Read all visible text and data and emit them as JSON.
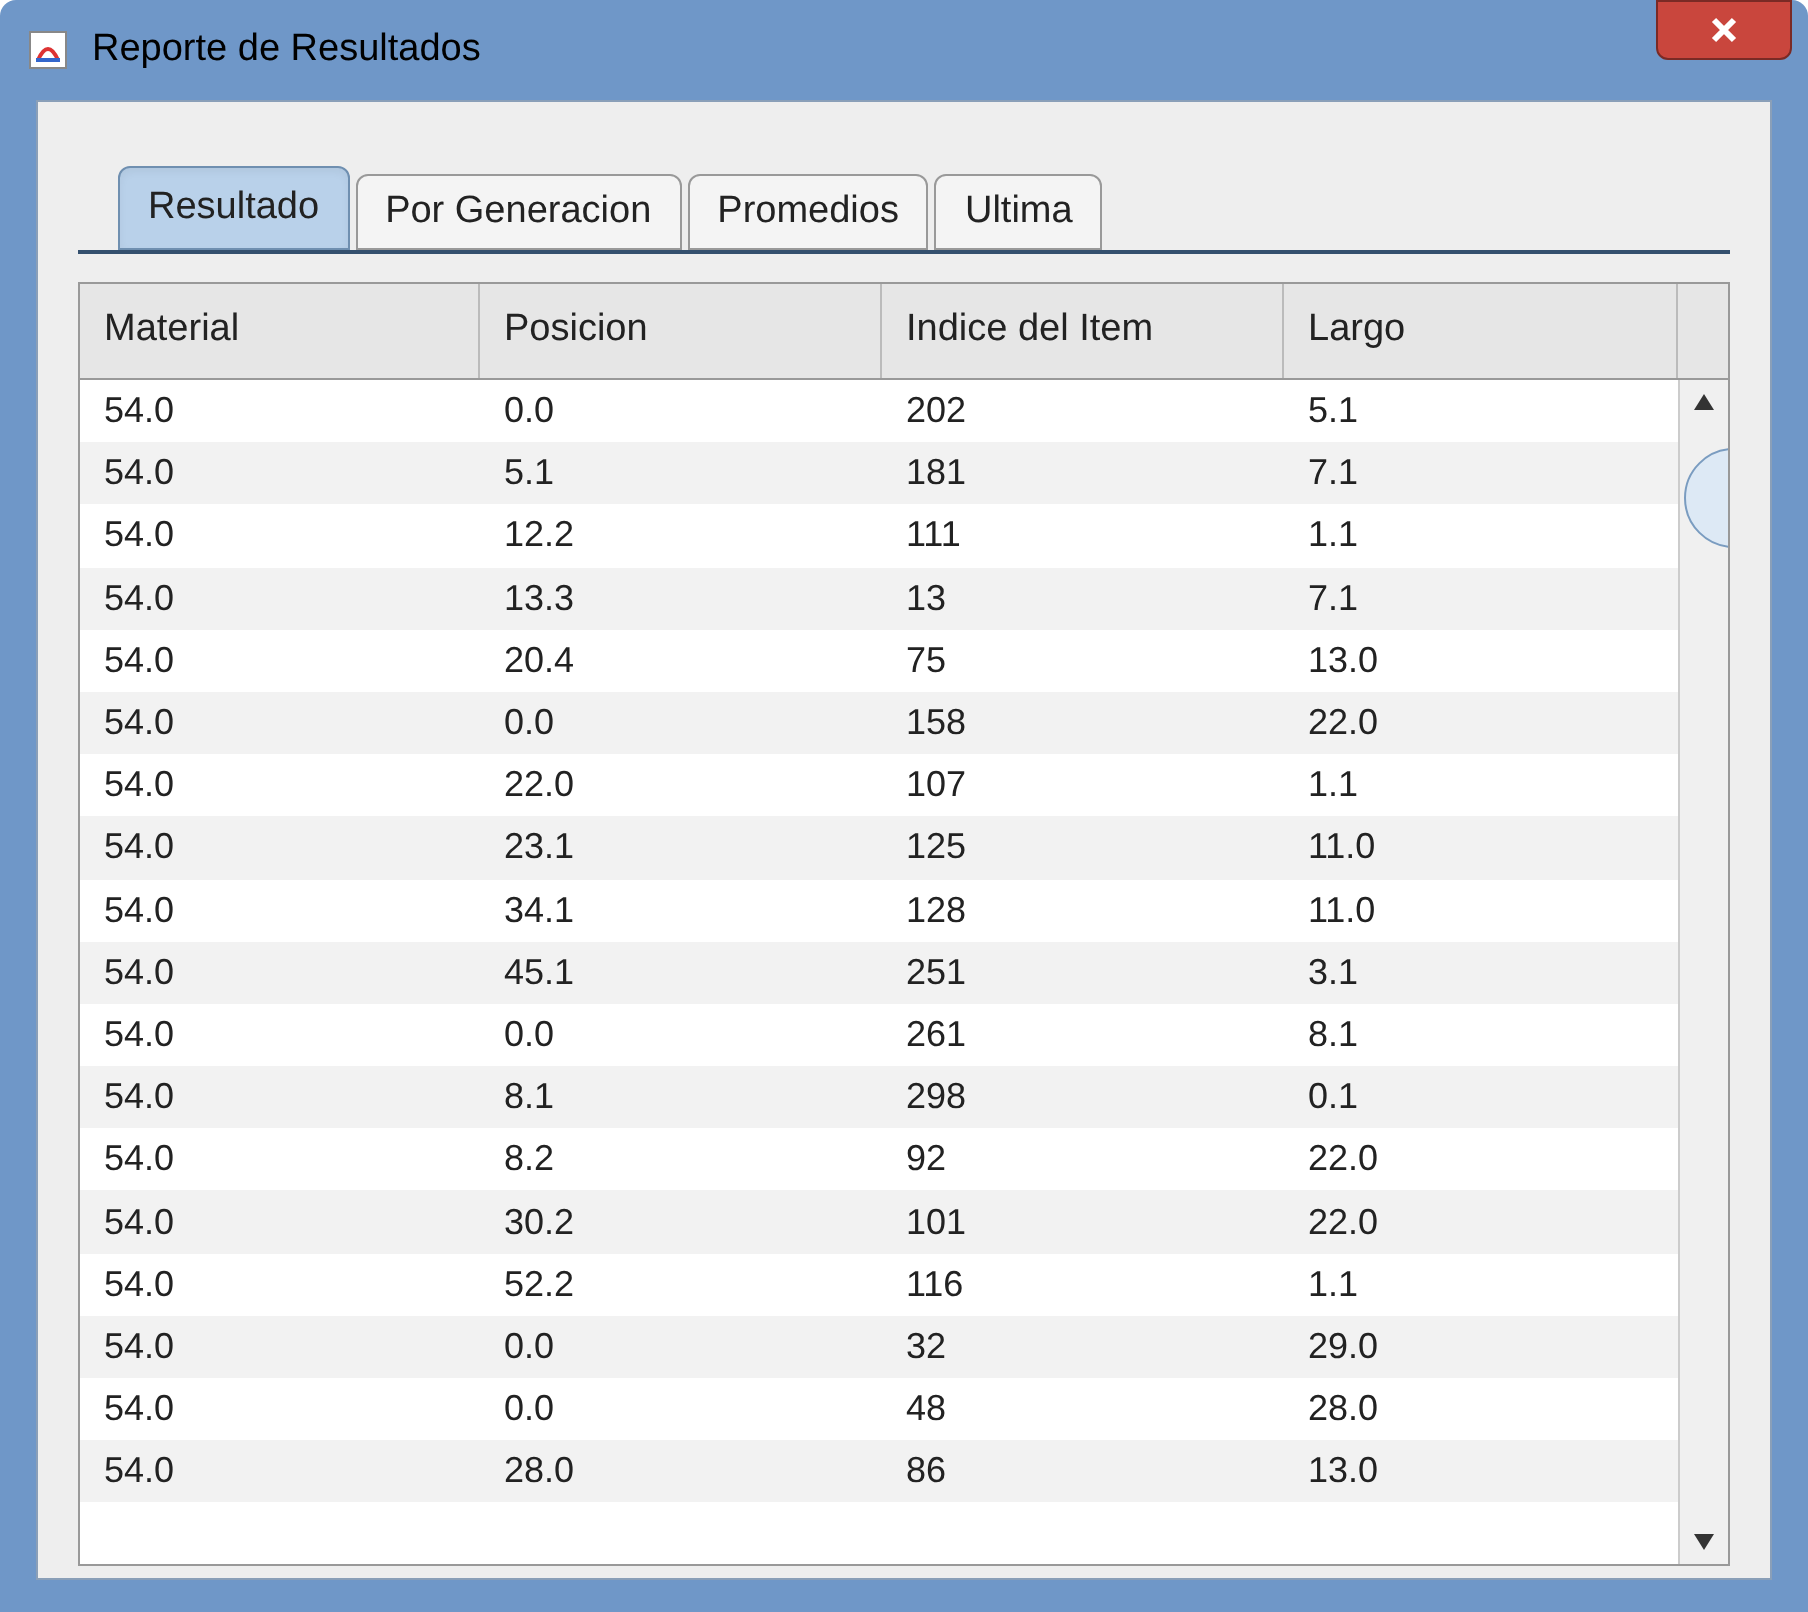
{
  "window": {
    "title": "Reporte de Resultados"
  },
  "tabs": [
    {
      "label": "Resultado",
      "selected": true
    },
    {
      "label": "Por Generacion",
      "selected": false
    },
    {
      "label": "Promedios",
      "selected": false
    },
    {
      "label": "Ultima",
      "selected": false
    }
  ],
  "table": {
    "columns": [
      "Material",
      "Posicion",
      "Indice del Item",
      "Largo"
    ],
    "rows": [
      [
        "54.0",
        "0.0",
        "202",
        "5.1"
      ],
      [
        "54.0",
        "5.1",
        "181",
        "7.1"
      ],
      [
        "54.0",
        "12.2",
        "111",
        "1.1"
      ],
      [
        "54.0",
        "13.3",
        "13",
        "7.1"
      ],
      [
        "54.0",
        "20.4",
        "75",
        "13.0"
      ],
      [
        "54.0",
        "0.0",
        "158",
        "22.0"
      ],
      [
        "54.0",
        "22.0",
        "107",
        "1.1"
      ],
      [
        "54.0",
        "23.1",
        "125",
        "11.0"
      ],
      [
        "54.0",
        "34.1",
        "128",
        "11.0"
      ],
      [
        "54.0",
        "45.1",
        "251",
        "3.1"
      ],
      [
        "54.0",
        "0.0",
        "261",
        "8.1"
      ],
      [
        "54.0",
        "8.1",
        "298",
        "0.1"
      ],
      [
        "54.0",
        "8.2",
        "92",
        "22.0"
      ],
      [
        "54.0",
        "30.2",
        "101",
        "22.0"
      ],
      [
        "54.0",
        "52.2",
        "116",
        "1.1"
      ],
      [
        "54.0",
        "0.0",
        "32",
        "29.0"
      ],
      [
        "54.0",
        "0.0",
        "48",
        "28.0"
      ],
      [
        "54.0",
        "28.0",
        "86",
        "13.0"
      ]
    ]
  }
}
